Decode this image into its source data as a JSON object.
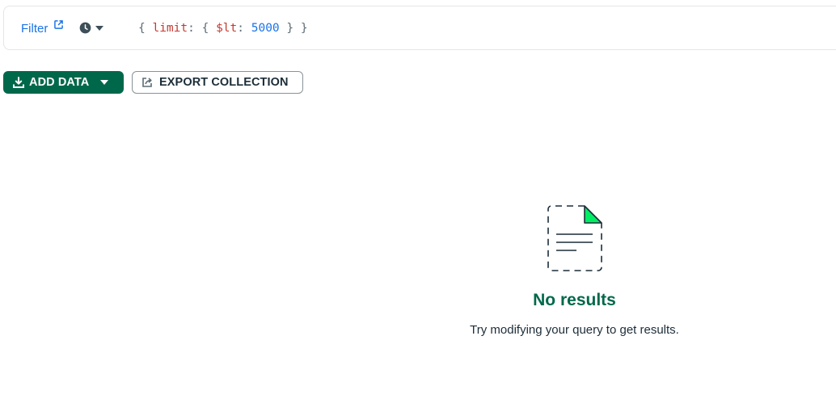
{
  "query_bar": {
    "filter_label": "Filter",
    "query": {
      "open_brace": "{ ",
      "key": "limit",
      "colon1": ": ",
      "inner_open": "{ ",
      "operator": "$lt",
      "colon2": ": ",
      "value": "5000",
      "inner_close": " }",
      "close_brace": " }"
    }
  },
  "toolbar": {
    "add_data_label": "ADD DATA",
    "export_label": "EXPORT COLLECTION"
  },
  "empty_state": {
    "title": "No results",
    "description": "Try modifying your query to get results."
  },
  "colors": {
    "primary": "#00684a",
    "link": "#1a73e8",
    "keyword": "#c5392f",
    "accent": "#00ed64"
  }
}
